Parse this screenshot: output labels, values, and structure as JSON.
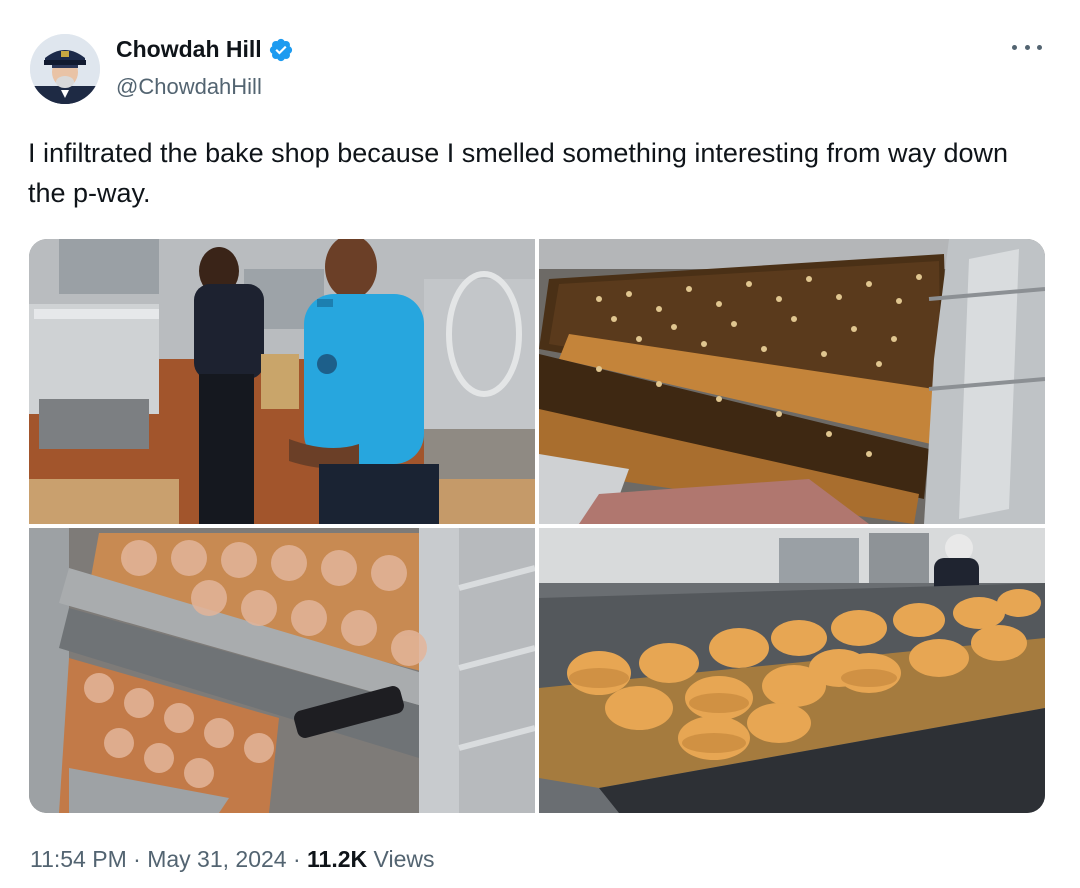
{
  "author": {
    "name": "Chowdah Hill",
    "handle": "@ChowdahHill",
    "verified": true,
    "avatar_icon": "avatar-naval-officer"
  },
  "more_icon": "more-horizontal-icon",
  "tweet": {
    "text": "I infiltrated the bake shop because I smelled something interesting from way down the p-way."
  },
  "media": [
    {
      "name": "photo-bakers-in-kitchen"
    },
    {
      "name": "photo-sheet-pans-with-nut-topping"
    },
    {
      "name": "photo-cinnamon-rolls-on-rack"
    },
    {
      "name": "photo-muffins-on-trays"
    }
  ],
  "meta": {
    "time": "11:54 PM",
    "separator": " · ",
    "date": "May 31, 2024",
    "views_count": "11.2K",
    "views_label": "Views"
  },
  "colors": {
    "verified": "#1d9bf0",
    "secondary_text": "#536471",
    "primary_text": "#0f1419"
  }
}
